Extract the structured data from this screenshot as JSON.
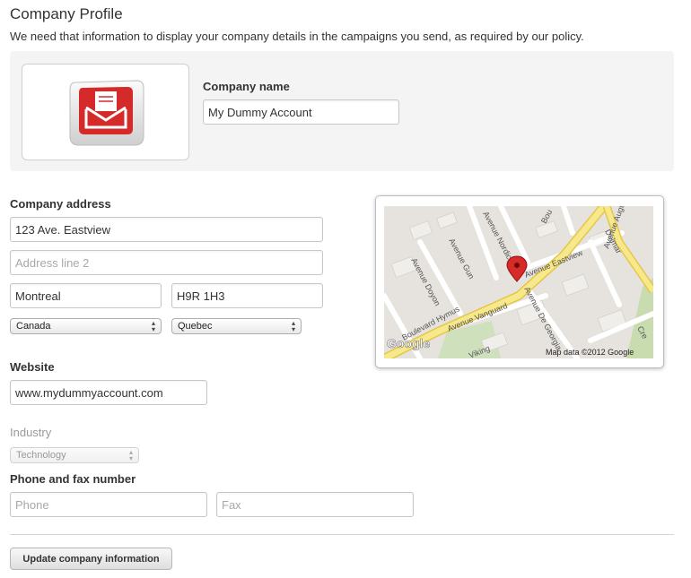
{
  "header": {
    "title": "Company Profile",
    "subtitle": "We need that information to display your company details in the campaigns you send, as required by our policy."
  },
  "logo": {
    "icon": "envelope-logo-icon",
    "accent_color": "#d42a2a"
  },
  "company": {
    "name_label": "Company name",
    "name_value": "My Dummy Account"
  },
  "address": {
    "label": "Company address",
    "line1_value": "123 Ave. Eastview",
    "line2_placeholder": "Address line 2",
    "city_value": "Montreal",
    "postal_value": "H9R 1H3",
    "country_value": "Canada",
    "province_value": "Quebec"
  },
  "map": {
    "attribution": "Map data ©2012 Google",
    "logo_text": "Google",
    "streets": {
      "hymus": "Boulevard Hymus",
      "bou": "Bou",
      "delmar": "Delmar",
      "nordic": "Avenue Nordic",
      "gun": "Avenue Gun",
      "doyon": "Avenue Doyon",
      "eastview": "Avenue Eastview",
      "georgia": "Avenue De Georgia",
      "vanguard": "Avenue Vanguard",
      "augusta": "Avenue Augusta",
      "viking": "Viking",
      "cre": "Cre"
    }
  },
  "website": {
    "label": "Website",
    "value": "www.mydummyaccount.com"
  },
  "industry": {
    "label": "Industry",
    "value": "Technology"
  },
  "phone": {
    "label": "Phone and fax number",
    "phone_placeholder": "Phone",
    "fax_placeholder": "Fax"
  },
  "actions": {
    "update_label": "Update company information"
  }
}
